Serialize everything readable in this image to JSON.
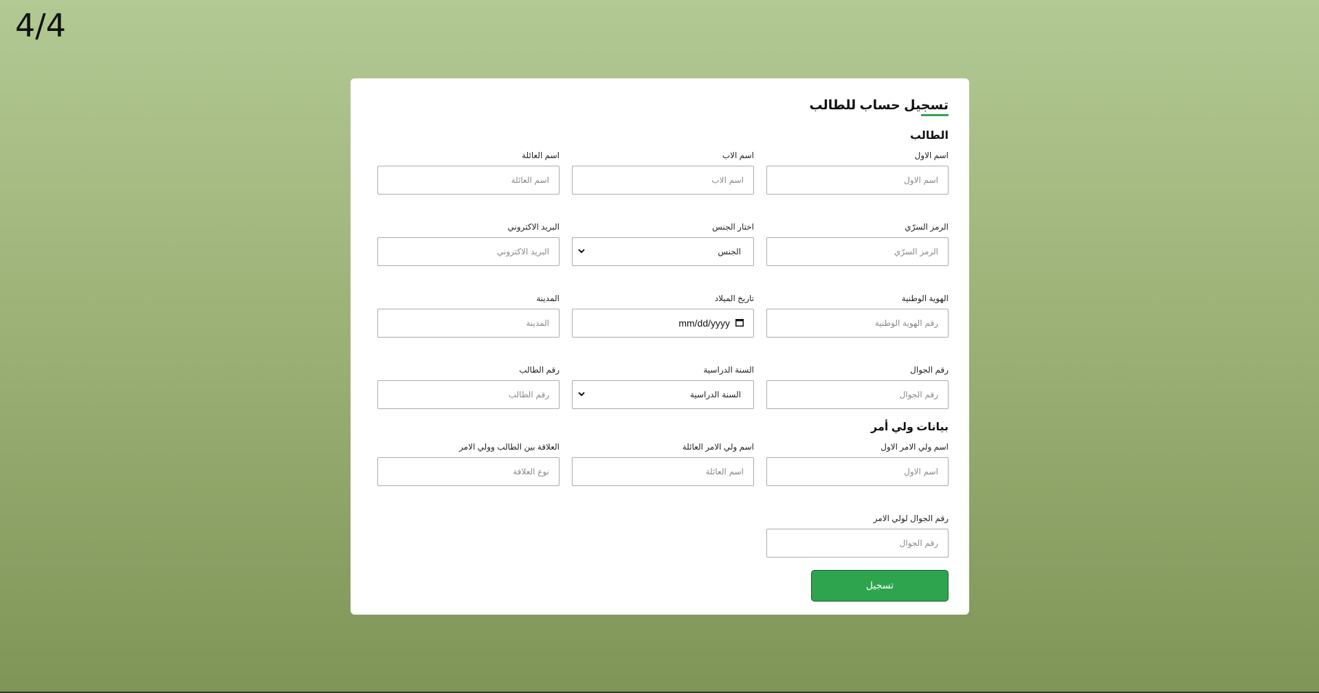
{
  "page_counter": "4/4",
  "form": {
    "title": "تسجيل حساب للطالب",
    "student_section": "الطالب",
    "fields": {
      "first_name": {
        "label": "اسم الاول",
        "placeholder": "اسم الاول"
      },
      "father_name": {
        "label": "اسم الاب",
        "placeholder": "اسم الاب"
      },
      "family_name": {
        "label": "اسم العائلة",
        "placeholder": "اسم العائلة"
      },
      "password": {
        "label": "الرمز السرّي",
        "placeholder": "الرمز السرّي"
      },
      "gender": {
        "label": "اختار الجنس",
        "selected": "الجنس"
      },
      "email": {
        "label": "البريد الاكتروني",
        "placeholder": "البريد الاكتروني"
      },
      "national_id": {
        "label": "الهوية الوطنية",
        "placeholder": "رقم الهوية الوطنية"
      },
      "birth_date": {
        "label": "تاريخ الميلاد",
        "value": "mm/dd/yyyy"
      },
      "city": {
        "label": "المدينة",
        "placeholder": "المدينة"
      },
      "mobile": {
        "label": "رقم الجوال",
        "placeholder": "رقم الجوال"
      },
      "school_year": {
        "label": "السنة الدراسية",
        "selected": "السنة الدراسية"
      },
      "student_number": {
        "label": "رقم الطالب",
        "placeholder": "رقم الطالب"
      }
    },
    "guardian_section": "بيانات ولي أمر",
    "guardian": {
      "first_name": {
        "label": "اسم ولي الامر الاول",
        "placeholder": "اسم الاول"
      },
      "family_name": {
        "label": "اسم ولي الامر العائلة",
        "placeholder": "اسم العائلة"
      },
      "relation": {
        "label": "العلاقة بين الطالب وولي الامر",
        "placeholder": "نوع العلاقة"
      },
      "mobile": {
        "label": "رقم الجوال لولي الامر",
        "placeholder": "رقم الجوال"
      }
    },
    "submit_label": "تسجيل"
  },
  "colors": {
    "accent": "#2ea44f"
  }
}
